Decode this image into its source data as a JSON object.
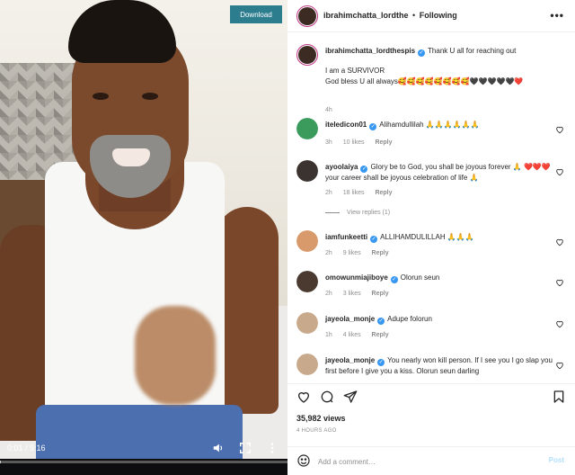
{
  "video": {
    "download_label": "Download",
    "time_display": "0:01 / 9:16",
    "progress": 0.002
  },
  "post": {
    "author": "ibrahimchatta_lordthe",
    "separator": "•",
    "follow_label": "Following",
    "caption_user": "ibrahimchatta_lordthespis",
    "caption_line1": "Thank U all for reaching out",
    "caption_line2": "I am a SURVIVOR",
    "caption_line3": "God bless U all always🥰🥰🥰🥰🥰🥰🥰🥰🖤🖤🖤🖤🖤❤️",
    "caption_time": "4h"
  },
  "comments": [
    {
      "user": "iteledicon01",
      "verified": true,
      "text": "Alihamdullilah 🙏🙏🙏🙏🙏🙏",
      "time": "3h",
      "likes": "10 likes",
      "reply": "Reply",
      "avatar_color": "#3a9b5c"
    },
    {
      "user": "ayoolaiya",
      "verified": true,
      "text": "Glory be to God, you shall be joyous forever 🙏 ❤️❤️❤️ your career shall be joyous celebration of life 🙏",
      "time": "2h",
      "likes": "18 likes",
      "reply": "Reply",
      "avatar_color": "#3b3330",
      "view_replies": "View replies (1)"
    },
    {
      "user": "iamfunkeetti",
      "verified": true,
      "text": "ALLIHAMDULILLAH 🙏🙏🙏",
      "time": "2h",
      "likes": "9 likes",
      "reply": "Reply",
      "avatar_color": "#d89a6a"
    },
    {
      "user": "omowunmiajiboye",
      "verified": true,
      "text": "Olorun seun",
      "time": "2h",
      "likes": "3 likes",
      "reply": "Reply",
      "avatar_color": "#4a3a30"
    },
    {
      "user": "jayeola_monje",
      "verified": true,
      "text": "Adupe folorun",
      "time": "1h",
      "likes": "4 likes",
      "reply": "Reply",
      "avatar_color": "#c9a98c"
    },
    {
      "user": "jayeola_monje",
      "verified": true,
      "text": "You nearly won kill person. If I see you I go slap you first before I give you a kiss. Olorun seun darling",
      "time": "",
      "likes": "",
      "reply": "",
      "avatar_color": "#c9a98c"
    }
  ],
  "stats": {
    "views": "35,982 views",
    "ago": "4 HOURS AGO"
  },
  "composer": {
    "placeholder": "Add a comment…",
    "post_label": "Post"
  }
}
